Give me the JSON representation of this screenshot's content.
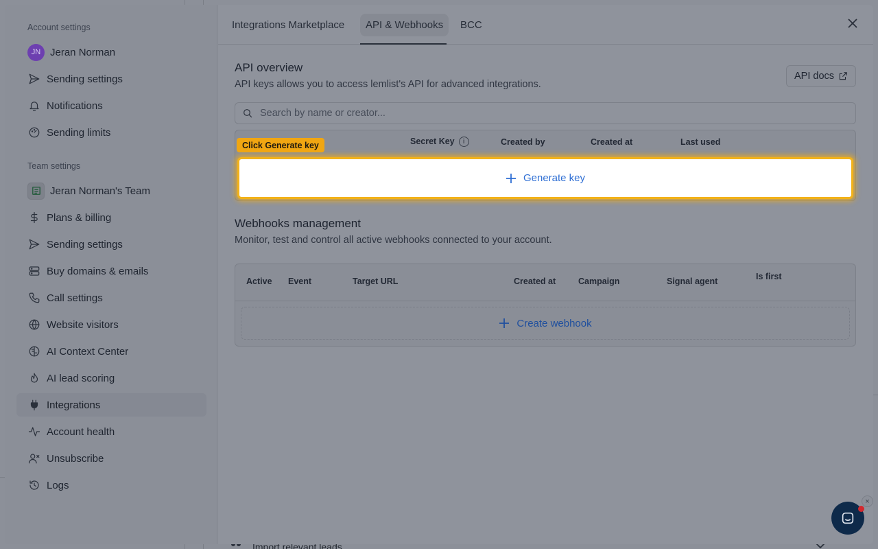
{
  "background": {
    "bottom_text": "Import relevant leads"
  },
  "sidebar": {
    "account_title": "Account settings",
    "team_title": "Team settings",
    "user": {
      "initials": "JN",
      "name": "Jeran Norman"
    },
    "account_items": [
      {
        "label": "Sending settings",
        "icon": "send-icon"
      },
      {
        "label": "Notifications",
        "icon": "bell-icon"
      },
      {
        "label": "Sending limits",
        "icon": "gauge-icon"
      }
    ],
    "team_name": "Jeran Norman's Team",
    "team_items": [
      {
        "label": "Plans & billing",
        "icon": "dollar-icon"
      },
      {
        "label": "Sending settings",
        "icon": "send-icon"
      },
      {
        "label": "Buy domains & emails",
        "icon": "server-icon"
      },
      {
        "label": "Call settings",
        "icon": "phone-icon"
      },
      {
        "label": "Website visitors",
        "icon": "globe-icon"
      },
      {
        "label": "AI Context Center",
        "icon": "brain-icon"
      },
      {
        "label": "AI lead scoring",
        "icon": "flame-icon"
      },
      {
        "label": "Integrations",
        "icon": "plug-icon",
        "active": true
      },
      {
        "label": "Account health",
        "icon": "activity-icon"
      },
      {
        "label": "Unsubscribe",
        "icon": "user-x-icon"
      },
      {
        "label": "Logs",
        "icon": "history-icon"
      }
    ]
  },
  "tabs": [
    {
      "label": "Integrations Marketplace"
    },
    {
      "label": "API & Webhooks",
      "active": true
    },
    {
      "label": "BCC"
    }
  ],
  "api": {
    "title": "API overview",
    "subtitle": "API keys allows you to access lemlist's API for advanced integrations.",
    "docs_label": "API docs",
    "search_placeholder": "Search by name or creator...",
    "columns": [
      "Secret Key",
      "Created by",
      "Created at",
      "Last used"
    ],
    "info_glyph": "i",
    "tooltip": "Click Generate key",
    "generate_label": "Generate key"
  },
  "webhooks": {
    "title": "Webhooks management",
    "subtitle": "Monitor, test and control all active webhooks connected to your account.",
    "columns": [
      "Active",
      "Event",
      "Target URL",
      "Created at",
      "Campaign",
      "Signal agent",
      "Is first"
    ],
    "create_label": "Create webhook"
  },
  "chat": {
    "close_glyph": "×"
  },
  "colors": {
    "highlight": "#f2b21a",
    "link_blue": "#2f6fd4",
    "chat_bg": "#0e2a4a",
    "notification_dot": "#d2282e"
  }
}
